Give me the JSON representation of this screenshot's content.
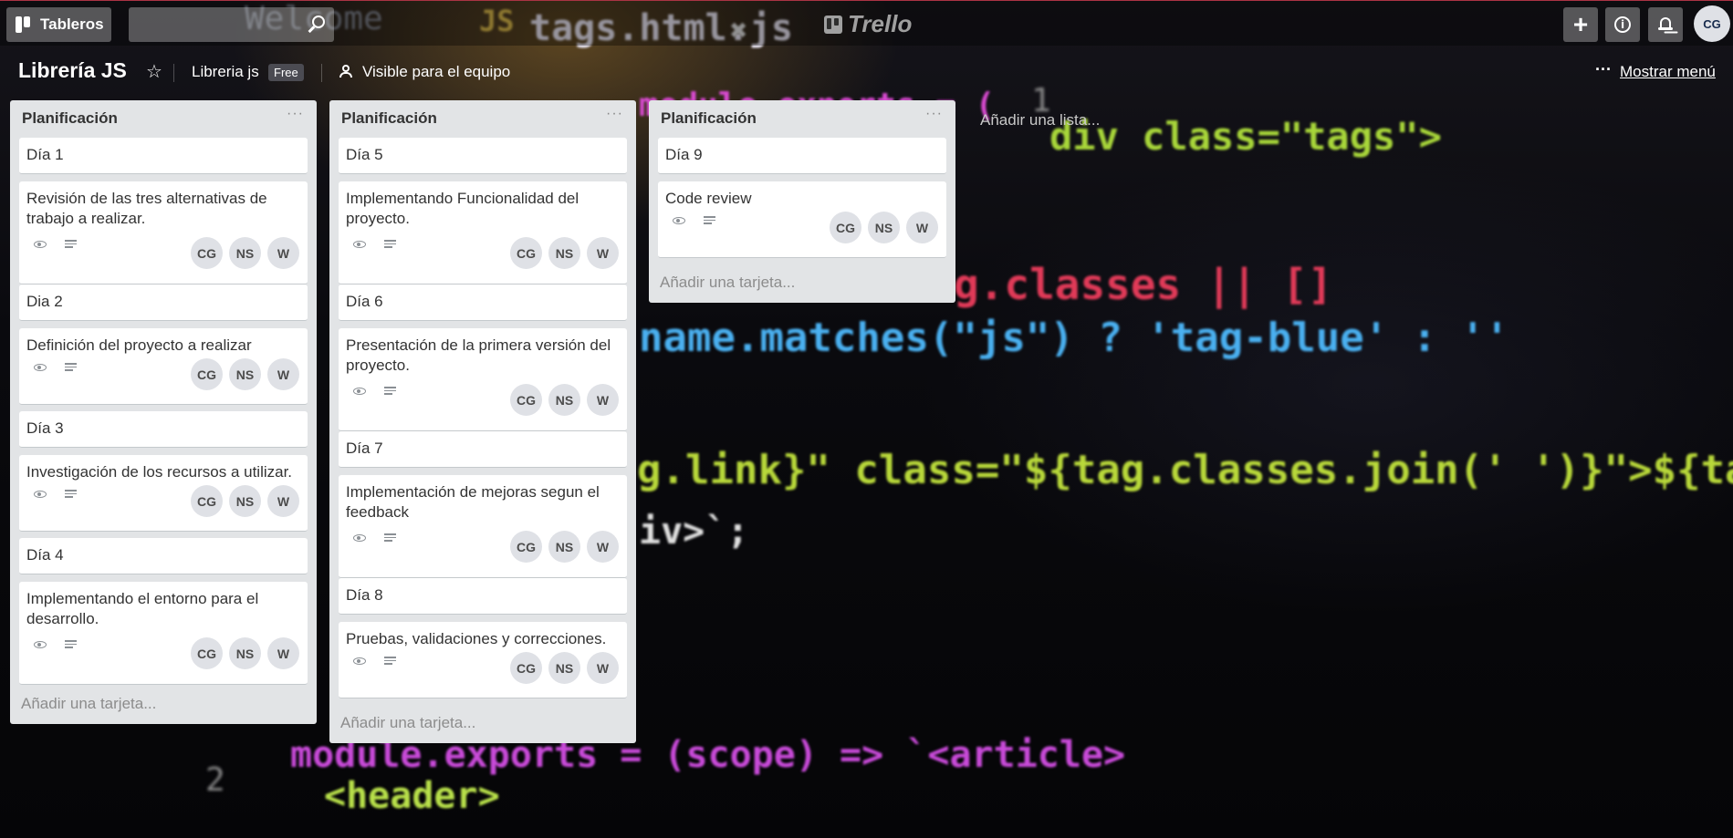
{
  "header": {
    "boards_label": "Tableros",
    "search_value": "",
    "logo_text": "Trello",
    "user_initials": "CG"
  },
  "board": {
    "title": "Librería JS",
    "team_name": "Libreria js",
    "plan_badge": "Free",
    "visibility_label": "Visible para el equipo",
    "menu_label": "Mostrar menú",
    "add_list_label": "Añadir una lista..."
  },
  "background_code": {
    "tab_title": "tags.html.js",
    "tab_js": "JS",
    "tab_close": "✖",
    "welcome": "Welcome",
    "line1": "module.exports = (",
    "line1b": "div class=\"tags\">",
    "line2": "g.classes || []",
    "line3": "name.matches(\"js\") ? 'tag-blue' : ''",
    "line4": "g.link}\" class=\"${tag.classes.join(' ')}\">${tag.n",
    "line5": "iv>`;",
    "line6": "module.exports = (scope) => `<article>",
    "line7": "<header>",
    "num1": "1",
    "num2": "2"
  },
  "lists": [
    {
      "title": "Planificación",
      "add_card_label": "Añadir una tarjeta...",
      "cards": [
        {
          "title": "Día 1"
        },
        {
          "title": "Revisión de las tres alternativas de trabajo a realizar.",
          "members": [
            "CG",
            "NS",
            "W"
          ]
        },
        {
          "title": "Dia 2"
        },
        {
          "title": "Definición del proyecto a realizar",
          "members": [
            "CG",
            "NS",
            "W"
          ]
        },
        {
          "title": "Día 3"
        },
        {
          "title": "Investigación de los recursos a utilizar.",
          "members": [
            "CG",
            "NS",
            "W"
          ]
        },
        {
          "title": "Día 4"
        },
        {
          "title": "Implementando el entorno para el desarrollo.",
          "members": [
            "CG",
            "NS",
            "W"
          ]
        }
      ]
    },
    {
      "title": "Planificación",
      "add_card_label": "Añadir una tarjeta...",
      "cards": [
        {
          "title": "Día 5"
        },
        {
          "title": "Implementando Funcionalidad del proyecto.",
          "members": [
            "CG",
            "NS",
            "W"
          ]
        },
        {
          "title": "Día 6"
        },
        {
          "title": "Presentación de la primera versión del proyecto.",
          "members": [
            "CG",
            "NS",
            "W"
          ]
        },
        {
          "title": "Día 7"
        },
        {
          "title": "Implementación de mejoras segun el feedback",
          "members": [
            "CG",
            "NS",
            "W"
          ]
        },
        {
          "title": "Día 8"
        },
        {
          "title": "Pruebas, validaciones y correcciones.",
          "members": [
            "CG",
            "NS",
            "W"
          ]
        }
      ]
    },
    {
      "title": "Planificación",
      "add_card_label": "Añadir una tarjeta...",
      "cards": [
        {
          "title": "Día 9"
        },
        {
          "title": "Code review",
          "members": [
            "CG",
            "NS",
            "W"
          ]
        }
      ]
    }
  ]
}
